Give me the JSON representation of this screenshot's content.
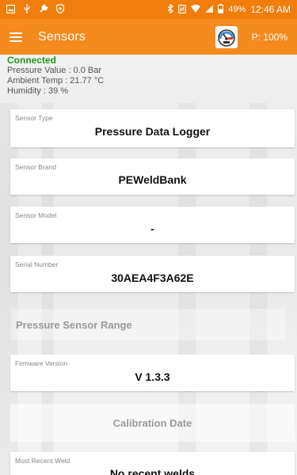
{
  "status_bar": {
    "battery": "49%",
    "time": "12:46 AM",
    "icons_left": [
      "image-icon",
      "usb-icon",
      "wrench-icon",
      "shield-icon"
    ],
    "icons_right": [
      "bluetooth-icon",
      "nfc-icon",
      "wifi-icon",
      "signal-icon",
      "battery-icon"
    ]
  },
  "app_bar": {
    "title": "Sensors",
    "pressure_label": "P: 100%"
  },
  "info": {
    "connection": "Connected",
    "pressure": "Pressure Value : 0.0 Bar",
    "ambient": "Ambient Temp : 21.77 °C",
    "humidity": "Humidity : 39 %"
  },
  "cards": {
    "sensor_type": {
      "label": "Sensor Type",
      "value": "Pressure Data Logger"
    },
    "sensor_brand": {
      "label": "Sensor Brand",
      "value": "PEWeldBank"
    },
    "sensor_model": {
      "label": "Sensor Model",
      "value": "-"
    },
    "serial_number": {
      "label": "Serial Number",
      "value": "30AEA4F3A62E"
    },
    "pressure_range": {
      "label": "Pressure Sensor Range"
    },
    "firmware": {
      "label": "Firmware Version",
      "value": "V 1.3.3"
    },
    "calibration": {
      "label": "Calibration Date"
    },
    "recent_weld": {
      "label": "Most Recent Weld",
      "value": "No recent welds"
    }
  },
  "colors": {
    "status_bar": "#f07d0c",
    "app_bar": "#f58a1f",
    "connected": "#1a9a1a"
  }
}
